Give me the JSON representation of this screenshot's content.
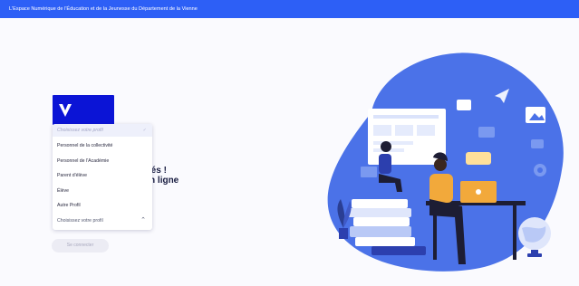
{
  "header": {
    "title": "L'Espace Numérique de l'Éducation et de la Jeunesse du Département de la Vienne"
  },
  "hero": {
    "title_line1": "nnectés !",
    "title_line2": "ces en ligne"
  },
  "profile_select": {
    "placeholder": "Choisissez votre profil",
    "options": [
      "Personnel de la collectivité",
      "Personnel de l'Académie",
      "Parent d'élève",
      "Élève",
      "Autre Profil"
    ],
    "footer_label": "Choisissez votre profil"
  },
  "connect_button": {
    "label": "Se connecter"
  },
  "colors": {
    "header": "#2d5ff6",
    "logo": "#0b14d6",
    "blob": "#4b72e8"
  },
  "icons": {
    "logo": "v-logo",
    "dropdown_open": "chevron-up-icon",
    "selected": "check-icon"
  }
}
